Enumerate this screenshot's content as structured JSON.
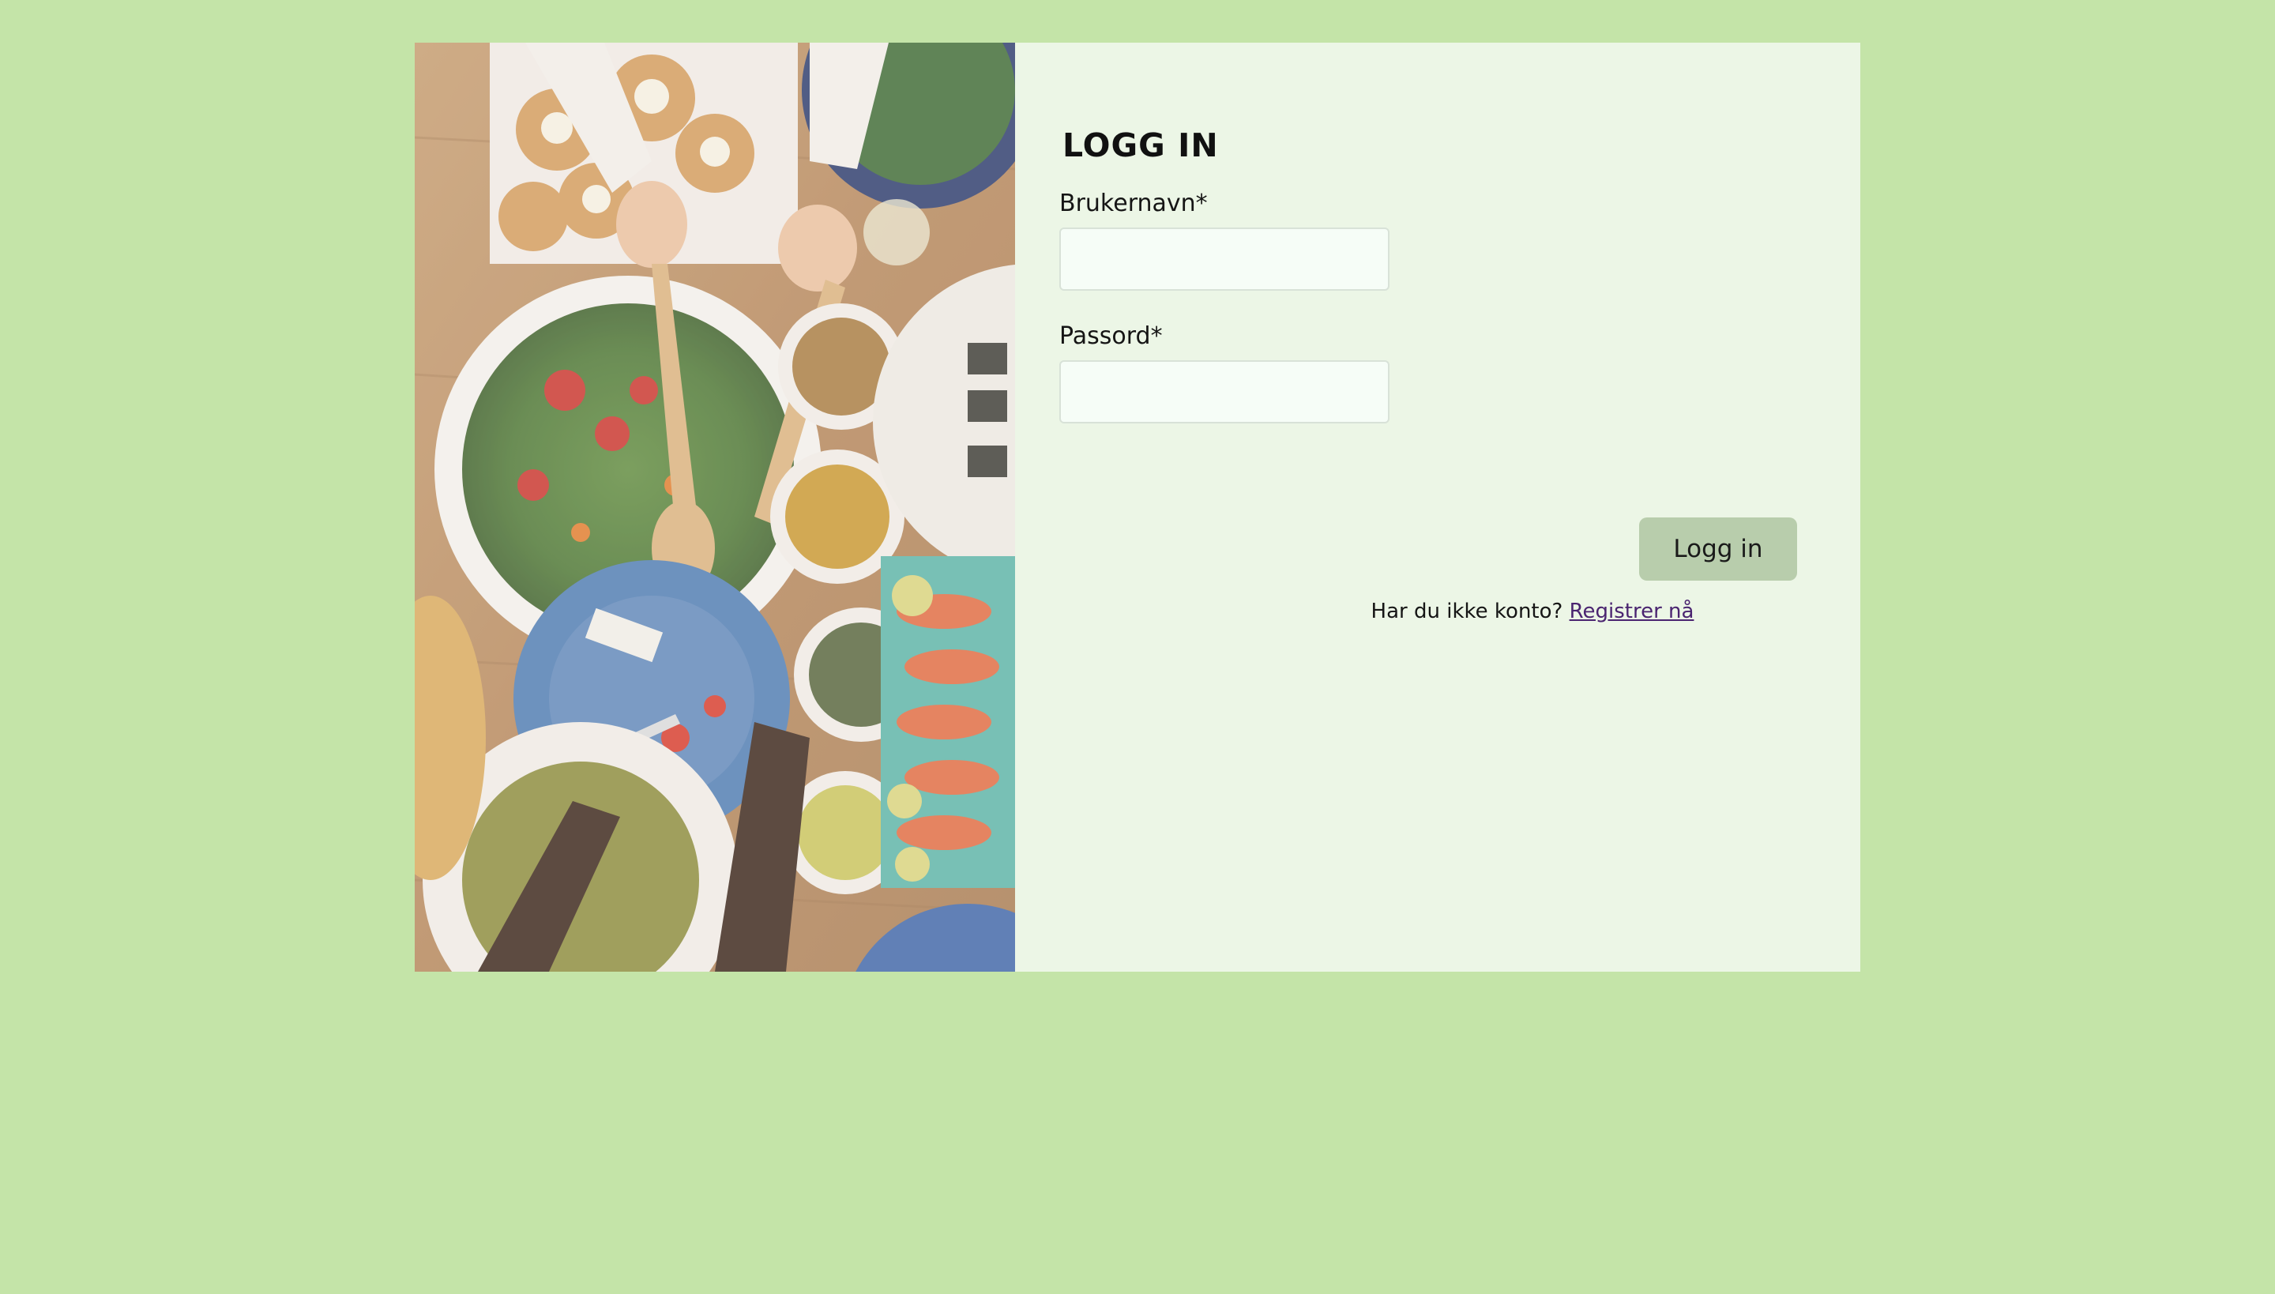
{
  "login": {
    "title": "LOGG IN",
    "username_label": "Brukernavn*",
    "username_value": "",
    "password_label": "Passord*",
    "password_value": "",
    "submit_label": "Logg in",
    "signup_prompt": "Har du ikke konto?",
    "signup_link": "Registrer nå"
  },
  "colors": {
    "page_background": "#c4e4a8",
    "panel_background": "#ecf6e6",
    "button_background": "#b8cdac",
    "link": "#4a2470"
  },
  "image": {
    "subject": "overhead-food-table-photo"
  }
}
